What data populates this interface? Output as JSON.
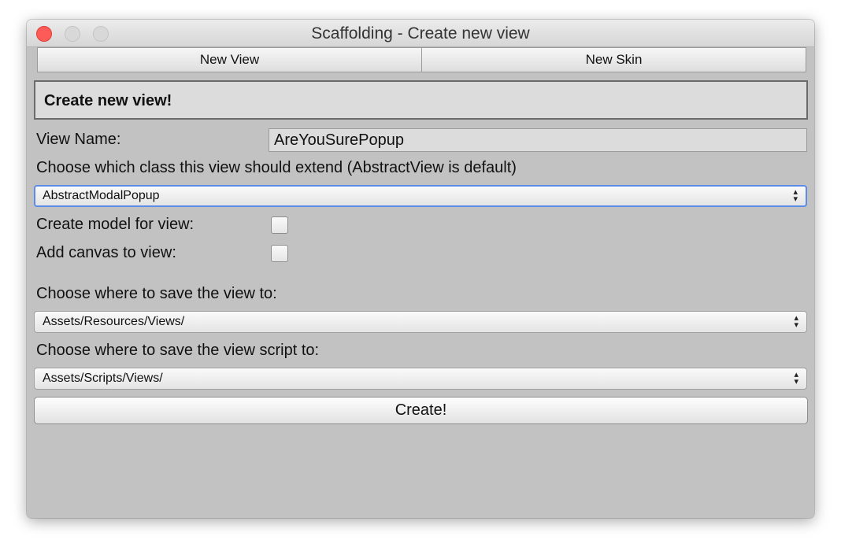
{
  "window": {
    "title": "Scaffolding - Create new view",
    "controls": [
      "close-button",
      "minimize-button",
      "zoom-button"
    ],
    "colors": {
      "close": "#fc5b57",
      "background": "#c2c2c2"
    }
  },
  "tabs": [
    {
      "label": "New View"
    },
    {
      "label": "New Skin"
    }
  ],
  "form": {
    "header": "Create new view!",
    "view_name_label": "View Name:",
    "view_name_value": "AreYouSurePopup",
    "extend_label": "Choose which class this view should extend (AbstractView is default)",
    "extend_selected": "AbstractModalPopup",
    "model_label": "Create model for view:",
    "model_checked": false,
    "canvas_label": "Add canvas to view:",
    "canvas_checked": false,
    "save_view_label": "Choose where to save the view to:",
    "save_view_selected": "Assets/Resources/Views/",
    "save_script_label": "Choose where to save the view script to:",
    "save_script_selected": "Assets/Scripts/Views/",
    "create_button": "Create!"
  },
  "icons": {
    "select_arrows": "up-down-arrows-icon",
    "select_arrows_glyph": "▲▼"
  }
}
